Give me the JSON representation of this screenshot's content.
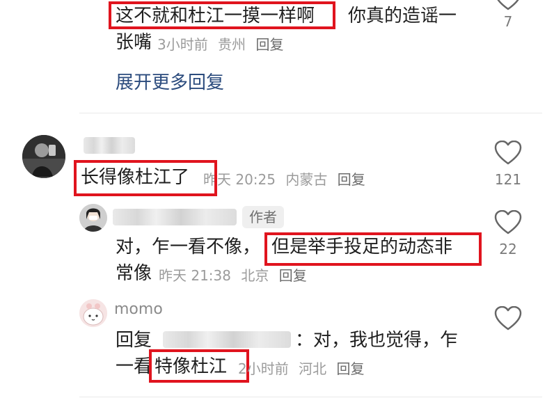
{
  "comments": [
    {
      "text_boxed": "这不就和杜江一摸一样啊",
      "text_rest": "你真的造谣一",
      "text_line2": "张嘴",
      "time": "3小时前",
      "location": "贵州",
      "reply_label": "回复",
      "like_count": "7",
      "expand_label": "展开更多回复"
    },
    {
      "username": "",
      "text": "长得像杜江了",
      "time": "昨天 20:25",
      "location": "内蒙古",
      "reply_label": "回复",
      "like_count": "121",
      "replies": [
        {
          "username": "",
          "author_badge": "作者",
          "text_start": "对，乍一看不像，",
          "text_boxed": "但是举手投足的动态非",
          "text_line2": "常像",
          "time": "昨天 21:38",
          "location": "北京",
          "reply_label": "回复",
          "like_count": "22"
        },
        {
          "username": "momo",
          "reply_prefix": "回复",
          "text_after_mention": "：对，我也觉得，乍",
          "text_line2_start": "一看",
          "text_boxed": "特像杜江",
          "time": "2小时前",
          "location": "河北",
          "reply_label": "回复",
          "like_count": ""
        }
      ]
    }
  ],
  "colors": {
    "highlight_box": "#e0141e",
    "link": "#2b4b7d",
    "meta": "#9b9b9b"
  },
  "icons": [
    "heart-outline-icon",
    "avatar-photo",
    "avatar-cartoon"
  ]
}
